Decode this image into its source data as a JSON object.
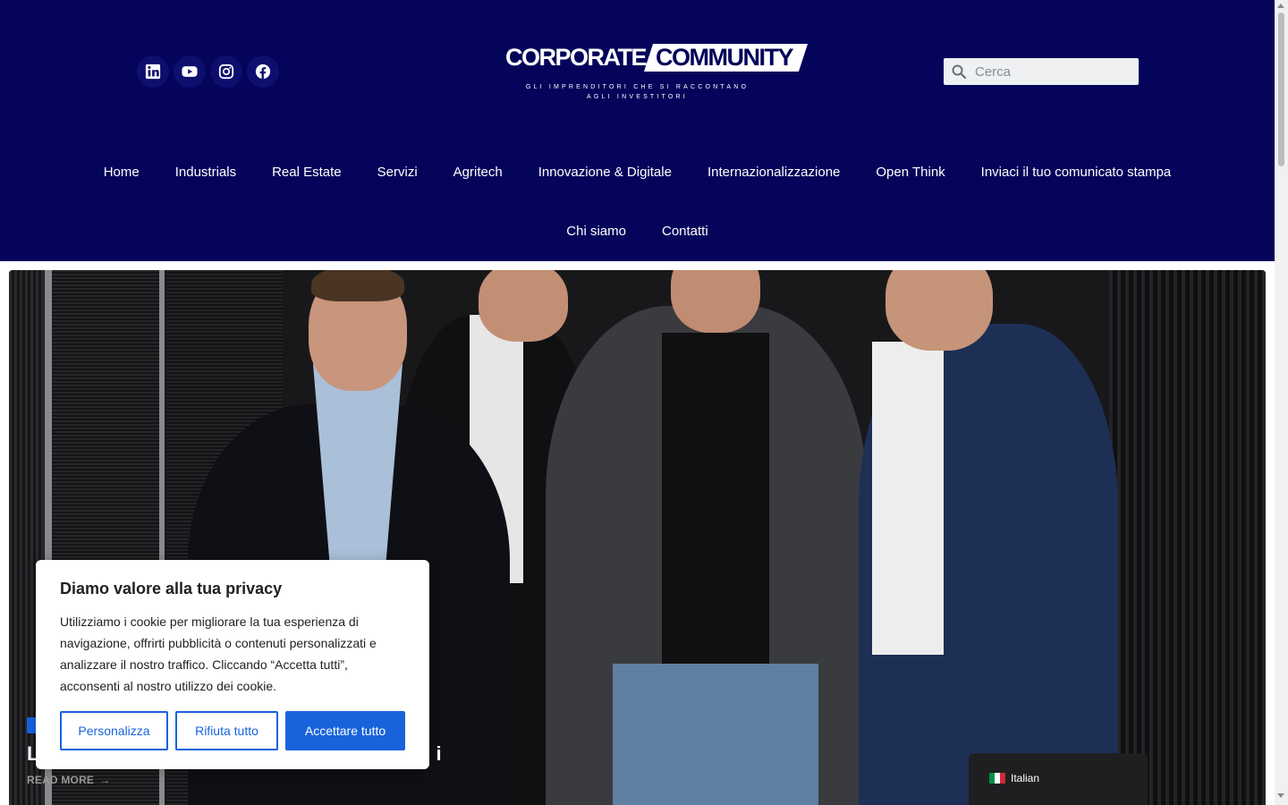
{
  "header": {
    "socials": [
      {
        "icon": "linkedin-icon"
      },
      {
        "icon": "youtube-icon"
      },
      {
        "icon": "instagram-icon"
      },
      {
        "icon": "facebook-icon"
      }
    ],
    "logo": {
      "word1": "CORPORATE",
      "word2": "COMMUNITY",
      "tagline_line1": "GLI IMPRENDITORI CHE SI RACCONTANO",
      "tagline_line2": "AGLI INVESTITORI"
    },
    "search": {
      "placeholder": "Cerca",
      "icon": "search-icon"
    },
    "nav_row1": [
      "Home",
      "Industrials",
      "Real Estate",
      "Servizi",
      "Agritech",
      "Innovazione & Digitale",
      "Internazionalizzazione",
      "Open Think",
      "Inviaci il tuo comunicato stampa"
    ],
    "nav_row2": [
      "Chi siamo",
      "Contatti"
    ]
  },
  "hero": {
    "title_visible": "L",
    "title_fragment_right": "i",
    "read_more": "READ MORE",
    "read_more_arrow": "→"
  },
  "cookie": {
    "title": "Diamo valore alla tua privacy",
    "text": "Utilizziamo i cookie per migliorare la tua esperienza di navigazione, offrirti pubblicità o contenuti personalizzati e analizzare il nostro traffico. Cliccando “Accetta tutti”, acconsenti al nostro utilizzo dei cookie.",
    "btn_customize": "Personalizza",
    "btn_reject": "Rifiuta tutto",
    "btn_accept": "Accettare tutto"
  },
  "language": {
    "label": "Italian",
    "flag": "italy-flag-icon"
  },
  "colors": {
    "header_bg": "#03045a",
    "accent": "#1863dc",
    "lang_bg": "#1f1f21"
  }
}
